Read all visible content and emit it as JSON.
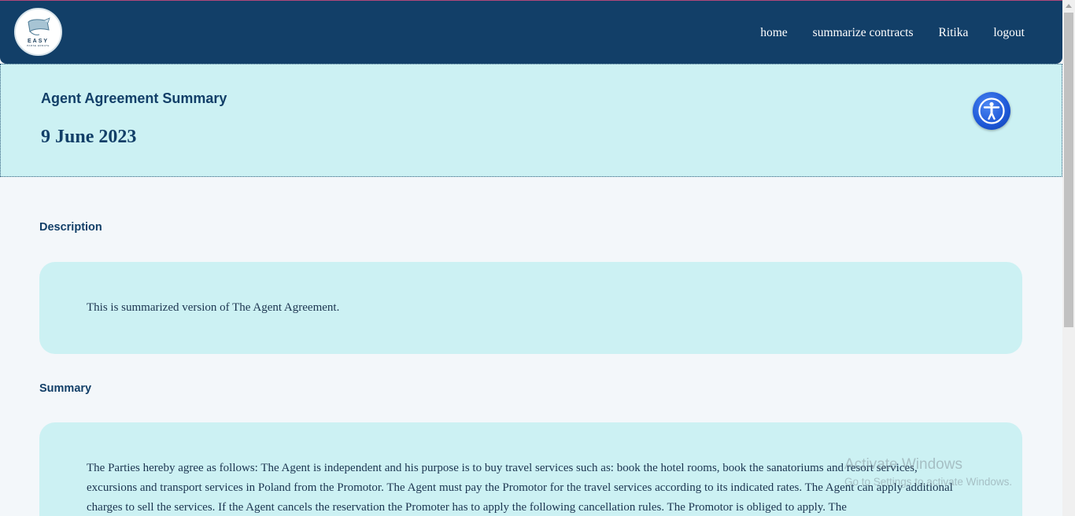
{
  "navbar": {
    "logo": {
      "brand": "EASY",
      "tagline": "PARSE ERRATE",
      "icon": "scroll-logo-icon"
    },
    "links": [
      "home",
      "summarize contracts",
      "Ritika",
      "logout"
    ]
  },
  "header": {
    "title": "Agent Agreement Summary",
    "date": "9 June 2023",
    "accessibility_icon": "accessibility-icon"
  },
  "description": {
    "label": "Description",
    "text": "This is summarized version of The Agent Agreement."
  },
  "summary": {
    "label": "Summary",
    "text": "The Parties hereby agree as follows: The Agent is independent and his purpose is to buy travel services such as: book the hotel rooms, book the sanatoriums and resort services, excursions and transport services in Poland from the Promotor. The Agent must pay the Promotor for the travel services according to its indicated rates. The Agent can apply additional charges to sell the services. If the Agent cancels the reservation the Promoter has to apply the following cancellation rules. The Promotor is obliged to apply. The"
  },
  "watermark": {
    "title": "Activate Windows",
    "subtitle": "Go to Settings to activate Windows."
  },
  "colors": {
    "navbar": "#123f68",
    "accent_light": "#ccf1f3",
    "background": "#f3f7fa",
    "a11y_blue": "#1d57d6"
  }
}
